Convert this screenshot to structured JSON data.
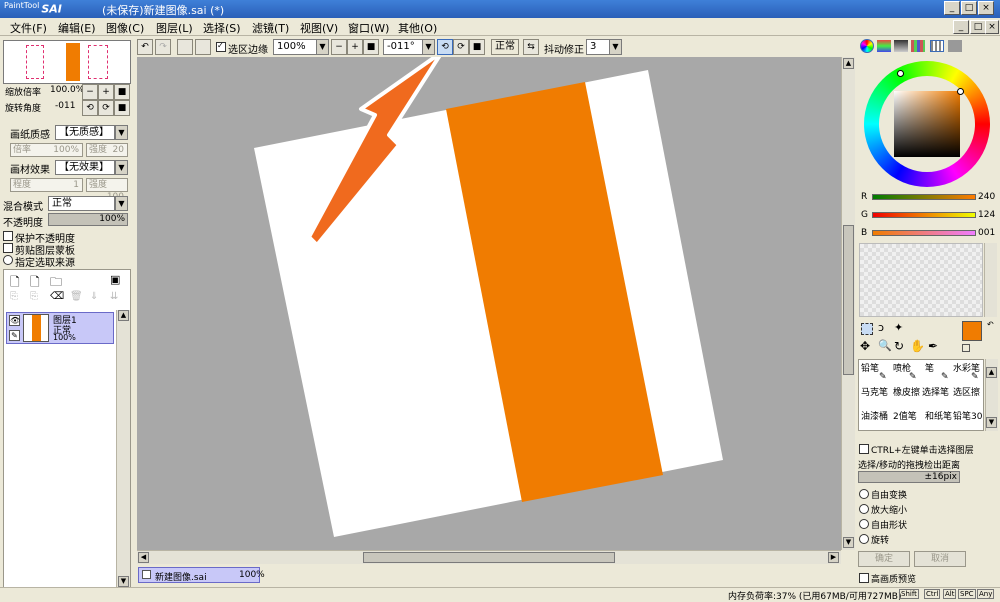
{
  "app": {
    "logo_sub": "PaintTool",
    "logo": "SAI",
    "window_title": "(未保存)新建图像.sai (*)"
  },
  "menu": [
    "文件(F)",
    "编辑(E)",
    "图像(C)",
    "图层(L)",
    "选择(S)",
    "滤镜(T)",
    "视图(V)",
    "窗口(W)",
    "其他(O)"
  ],
  "toolbar": {
    "selection_edge_label": "选区边缘",
    "zoom_value": "100%",
    "rotation_value": "-011°",
    "blend_label": "正常",
    "stabilizer_label": "抖动修正",
    "stabilizer_value": "3"
  },
  "navigator": {
    "zoom_label": "缩放倍率",
    "zoom_value": "100.0%",
    "rotate_label": "旋转角度",
    "rotate_value": "-011"
  },
  "paper": {
    "texture_label": "画纸质感",
    "texture_value": "【无质感】",
    "scale_label": "倍率",
    "scale_value": "100%",
    "strength_label": "强度",
    "strength_value": "20",
    "effect_label": "画材效果",
    "effect_value": "【无效果】",
    "degree_label": "程度",
    "degree_value": "1",
    "strength2_label": "强度",
    "strength2_value": "100"
  },
  "layer_props": {
    "blend_label": "混合模式",
    "blend_value": "正常",
    "opacity_label": "不透明度",
    "opacity_value": "100%",
    "preserve_opacity": "保护不透明度",
    "clipping": "剪贴图层蒙板",
    "selection_source": "指定选取来源"
  },
  "layers": [
    {
      "name": "图层1",
      "mode": "正常",
      "opacity": "100%"
    }
  ],
  "canvas_tab": {
    "name": "新建图像.sai",
    "zoom": "100%"
  },
  "color": {
    "r_label": "R",
    "r_value": "240",
    "g_label": "G",
    "g_value": "124",
    "b_label": "B",
    "b_value": "001",
    "r": 240,
    "g": 124,
    "b": 1,
    "foreground": "#f07c01",
    "accent_orange": "#f07c01"
  },
  "tools": [
    {
      "name": "铅笔"
    },
    {
      "name": "喷枪"
    },
    {
      "name": "笔"
    },
    {
      "name": "水彩笔"
    },
    {
      "name": "马克笔"
    },
    {
      "name": "橡皮擦"
    },
    {
      "name": "选择笔"
    },
    {
      "name": "选区擦"
    },
    {
      "name": "油漆桶"
    },
    {
      "name": "2值笔"
    },
    {
      "name": "和纸笔"
    },
    {
      "name": "铅笔30"
    }
  ],
  "tool_options": {
    "ctrl_select_layer": "CTRL+左键单击选择图层",
    "drag_distance_label": "选择/移动的拖拽检出距离",
    "drag_distance_value": "±16pix",
    "opt1": "自由变换",
    "opt2": "放大缩小",
    "opt3": "自由形状",
    "opt4": "旋转",
    "btn_ok": "确定",
    "btn_cancel": "取消",
    "hq_preview": "高画质预览"
  },
  "status": {
    "memory": "内存负荷率:37% (已用67MB/可用727MB)",
    "keys": [
      "Shift",
      "Ctrl",
      "Alt",
      "SPC",
      "Any"
    ]
  }
}
